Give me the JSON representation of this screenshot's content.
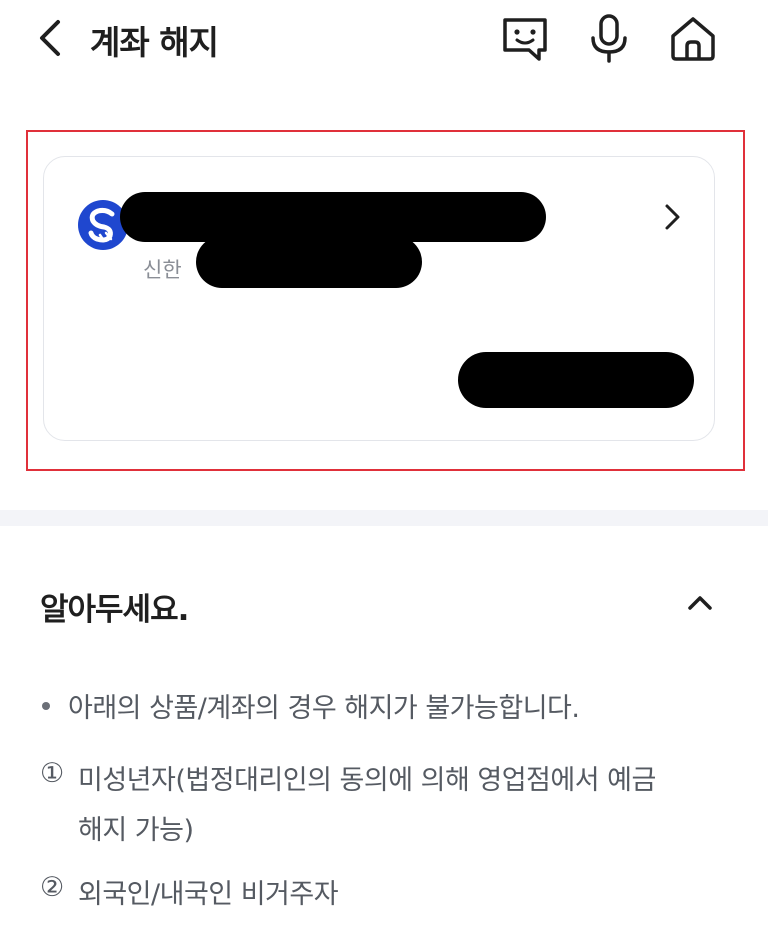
{
  "header": {
    "title": "계좌 해지",
    "icons": [
      "chevron-left-icon",
      "chat-icon",
      "mic-icon",
      "home-icon"
    ]
  },
  "account_card": {
    "bank_name": "신한",
    "logo_letter": "S",
    "logo_color": "#1f47cf",
    "highlight_color": "#e0303a"
  },
  "notice": {
    "title": "알아두세요.",
    "intro": "아래의 상품/계좌의 경우 해지가 불가능합니다.",
    "items": [
      {
        "marker": "①",
        "lines": [
          "미성년자(법정대리인의 동의에 의해 영업점에서 예금",
          "해지 가능)"
        ]
      },
      {
        "marker": "②",
        "lines": [
          "외국인/내국인 비거주자"
        ]
      }
    ]
  }
}
